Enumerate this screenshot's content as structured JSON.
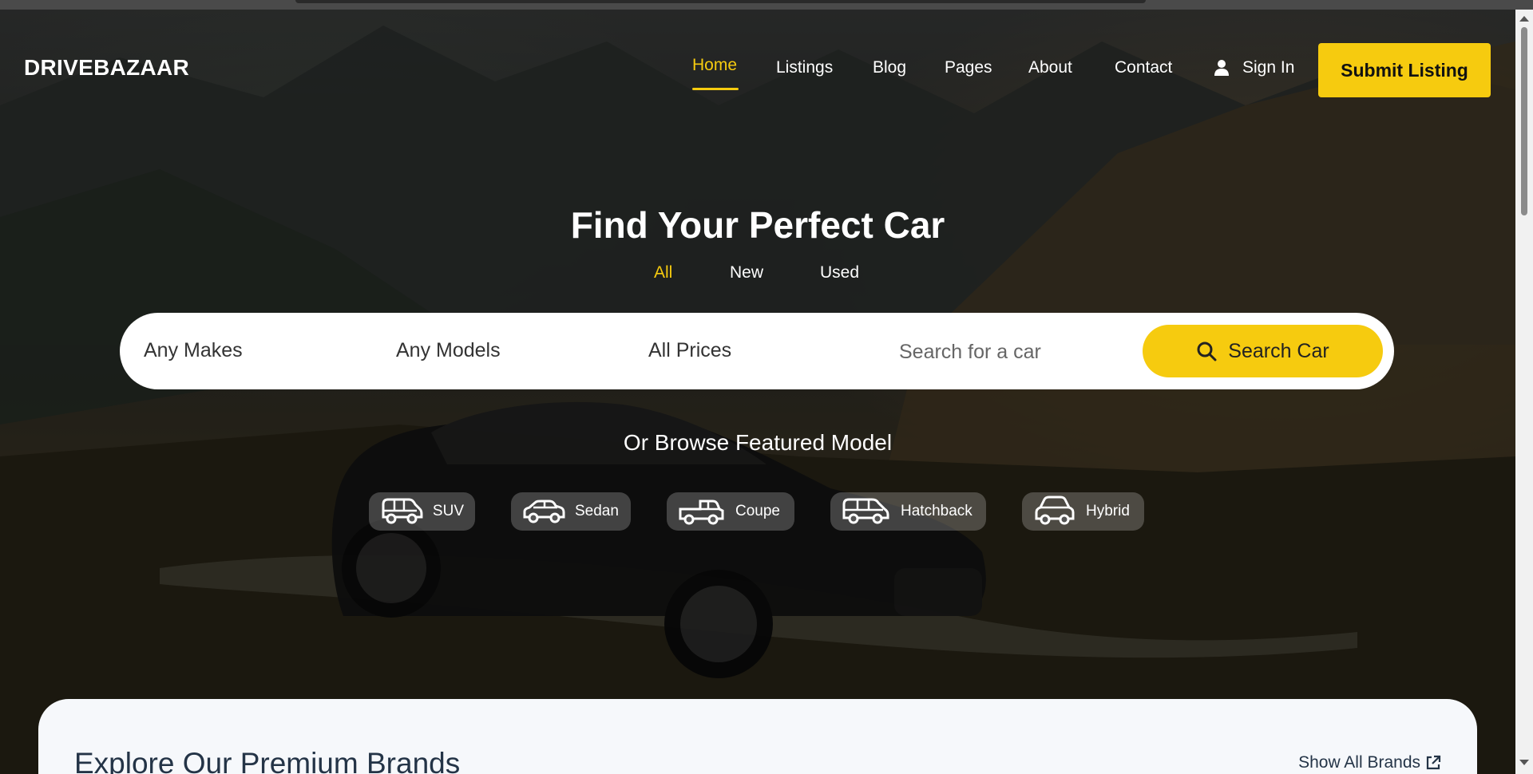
{
  "header": {
    "logo": "DRIVEBAZAAR",
    "nav": [
      "Home",
      "Listings",
      "Blog",
      "Pages",
      "About",
      "Contact"
    ],
    "active_nav": "Home",
    "sign_in": "Sign In",
    "submit_listing": "Submit Listing"
  },
  "hero": {
    "title": "Find Your Perfect Car",
    "tabs": [
      "All",
      "New",
      "Used"
    ],
    "active_tab": "All"
  },
  "search": {
    "make": "Any Makes",
    "model": "Any Models",
    "price": "All Prices",
    "placeholder": "Search for a car",
    "button": "Search Car"
  },
  "browse": {
    "title": "Or Browse Featured Model",
    "types": [
      {
        "label": "SUV",
        "icon": "suv-icon"
      },
      {
        "label": "Sedan",
        "icon": "sedan-icon"
      },
      {
        "label": "Coupe",
        "icon": "pickup-icon"
      },
      {
        "label": "Hatchback",
        "icon": "hatchback-icon"
      },
      {
        "label": "Hybrid",
        "icon": "hybrid-car-icon"
      }
    ]
  },
  "brands": {
    "title": "Explore Our Premium Brands",
    "show_all": "Show All Brands"
  },
  "colors": {
    "accent": "#f6cb0f",
    "text_dark": "#243447"
  }
}
